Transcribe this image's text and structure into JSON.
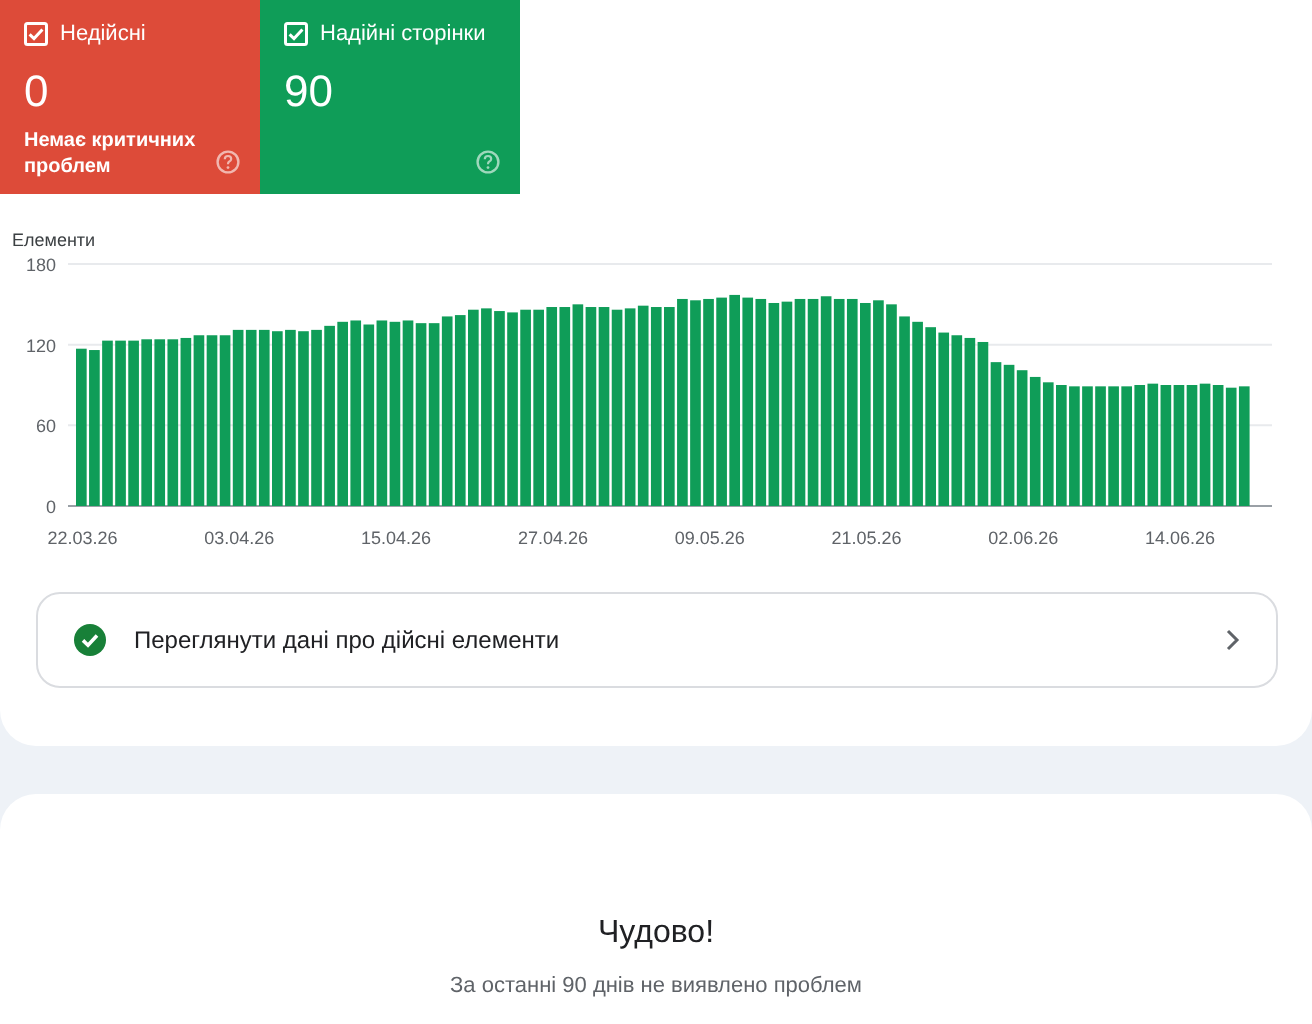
{
  "summary_cards": [
    {
      "label": "Недійсні",
      "checked": true,
      "color": "#dd4b39",
      "count": "0",
      "note": "Немає критичних проблем"
    },
    {
      "label": "Надійні сторінки",
      "checked": true,
      "color": "#0f9d58",
      "count": "90"
    }
  ],
  "chart": {
    "chart_data": {
      "type": "bar",
      "ylabel": "Елементи",
      "yticks": [
        0,
        60,
        120,
        180
      ],
      "ylim": [
        0,
        180
      ],
      "categories": [
        "22.03.26",
        null,
        null,
        null,
        null,
        null,
        null,
        null,
        null,
        null,
        null,
        null,
        "03.04.26",
        null,
        null,
        null,
        null,
        null,
        null,
        null,
        null,
        null,
        null,
        null,
        "15.04.26",
        null,
        null,
        null,
        null,
        null,
        null,
        null,
        null,
        null,
        null,
        null,
        "27.04.26",
        null,
        null,
        null,
        null,
        null,
        null,
        null,
        null,
        null,
        null,
        null,
        "09.05.26",
        null,
        null,
        null,
        null,
        null,
        null,
        null,
        null,
        null,
        null,
        null,
        "21.05.26",
        null,
        null,
        null,
        null,
        null,
        null,
        null,
        null,
        null,
        null,
        null,
        "02.06.26",
        null,
        null,
        null,
        null,
        null,
        null,
        null,
        null,
        null,
        null,
        null,
        "14.06.26",
        null,
        null,
        null,
        null,
        null
      ],
      "series": [
        {
          "color": "#0f9d58",
          "values": [
            117,
            116,
            123,
            123,
            123,
            124,
            124,
            124,
            125,
            127,
            127,
            127,
            131,
            131,
            131,
            130,
            131,
            130,
            131,
            134,
            137,
            138,
            135,
            138,
            137,
            138,
            136,
            136,
            141,
            142,
            146,
            147,
            145,
            144,
            146,
            146,
            148,
            148,
            150,
            148,
            148,
            146,
            147,
            149,
            148,
            148,
            154,
            153,
            154,
            155,
            157,
            155,
            154,
            151,
            152,
            154,
            154,
            156,
            154,
            154,
            151,
            153,
            150,
            141,
            137,
            133,
            129,
            127,
            125,
            122,
            107,
            105,
            101,
            96,
            92,
            90,
            89,
            89,
            89,
            89,
            89,
            90,
            91,
            90,
            90,
            90,
            91,
            90,
            88,
            89
          ]
        }
      ]
    }
  },
  "details_link": {
    "label": "Переглянути дані про дійсні елементи"
  },
  "empty_state": {
    "title": "Чудово!",
    "message": "За останні 90 днів не виявлено проблем"
  }
}
